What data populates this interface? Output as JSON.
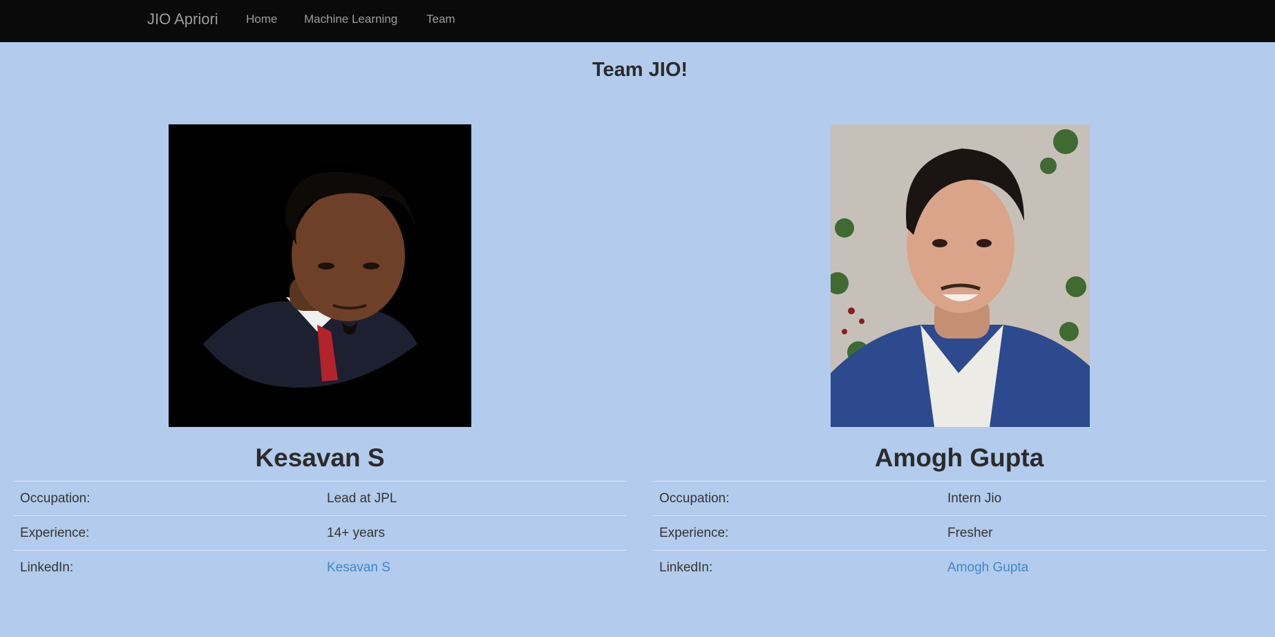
{
  "nav": {
    "brand": "JIO Apriori",
    "links": [
      {
        "label": "Home"
      },
      {
        "label": "Machine Learning"
      },
      {
        "label": "Team"
      }
    ]
  },
  "page": {
    "title": "Team JIO!"
  },
  "members": [
    {
      "name": "Kesavan S",
      "photo": "portrait-photo",
      "rows": [
        {
          "label": "Occupation:",
          "value": "Lead at JPL"
        },
        {
          "label": "Experience:",
          "value": "14+ years"
        },
        {
          "label": "LinkedIn:",
          "value": "Kesavan S"
        }
      ]
    },
    {
      "name": "Amogh Gupta",
      "photo": "portrait-photo",
      "rows": [
        {
          "label": "Occupation:",
          "value": "Intern Jio"
        },
        {
          "label": "Experience:",
          "value": "Fresher"
        },
        {
          "label": "LinkedIn:",
          "value": "Amogh Gupta"
        }
      ]
    }
  ],
  "colors": {
    "background": "#b3cbec",
    "navbar": "#0a0a0a",
    "nav_text": "#9d9d9d",
    "link": "#3e87cc"
  }
}
